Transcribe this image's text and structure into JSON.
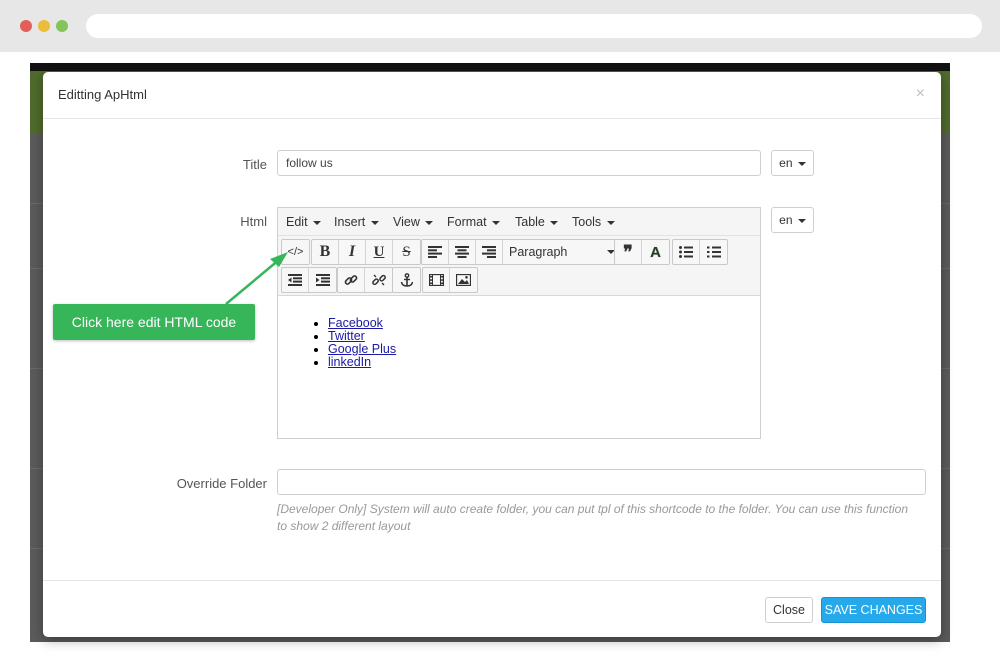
{
  "modal": {
    "title": "Editting ApHtml",
    "close_glyph": "×"
  },
  "form": {
    "title_label": "Title",
    "title_value": "follow us",
    "title_lang": "en",
    "html_label": "Html",
    "html_lang": "en",
    "override_label": "Override Folder",
    "override_value": "",
    "override_hint": "[Developer Only] System will auto create folder, you can put tpl of this shortcode to the folder. You can use this function to show 2 different layout"
  },
  "editor": {
    "menus": [
      "Edit",
      "Insert",
      "View",
      "Format",
      "Table",
      "Tools"
    ],
    "block_format": "Paragraph",
    "toolbar_glyphs": {
      "code": "</>",
      "bold": "B",
      "italic": "I",
      "underline": "U",
      "strike": "S",
      "quote": "❞",
      "text_color": "A"
    },
    "links": [
      "Facebook",
      "Twitter",
      "Google Plus",
      "linkedIn"
    ]
  },
  "footer": {
    "close_label": "Close",
    "save_label": "SAVE CHANGES"
  },
  "callout": {
    "text": "Click here edit HTML code",
    "color": "#36b559"
  },
  "colors": {
    "primary": "#25a9ea",
    "callout": "#36b559"
  }
}
